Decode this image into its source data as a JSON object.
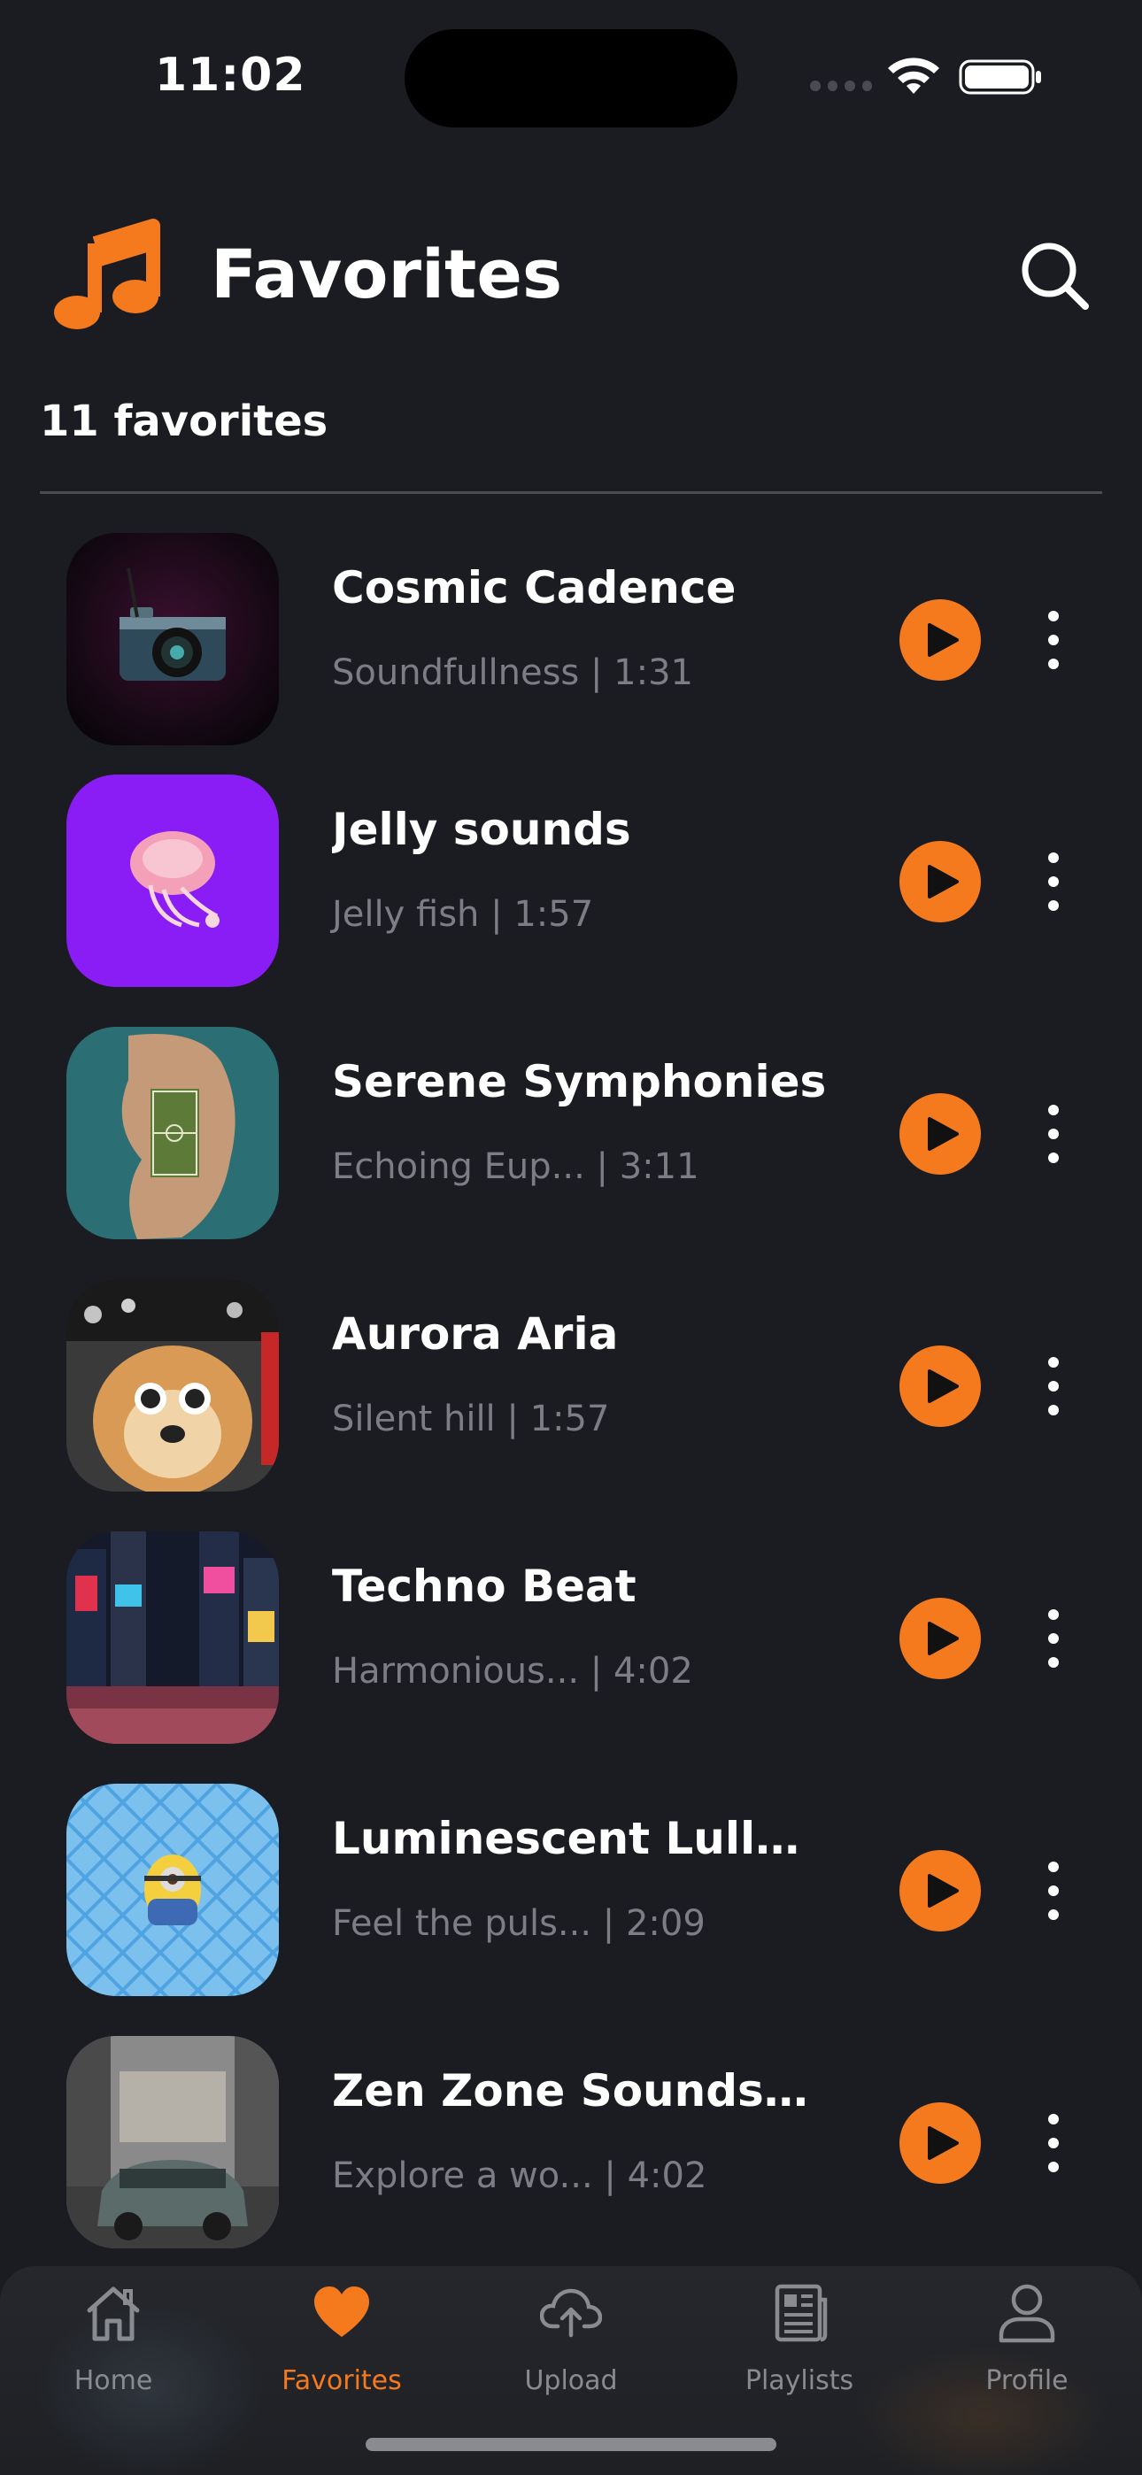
{
  "status_bar": {
    "time": "11:02"
  },
  "header": {
    "title": "Favorites"
  },
  "count_label": "11 favorites",
  "tracks": [
    {
      "title": "Cosmic Cadence",
      "meta": "Soundfullness | 1:31",
      "art": "camera-photo"
    },
    {
      "title": "Jelly sounds",
      "meta": "Jelly fish | 1:57",
      "art": "jellyfish-photo"
    },
    {
      "title": "Serene Symphonies",
      "meta": "Echoing Eup... | 3:11",
      "art": "island-field-photo"
    },
    {
      "title": "Aurora Aria",
      "meta": "Silent hill | 1:57",
      "art": "dog-sunglasses-photo"
    },
    {
      "title": "Techno Beat",
      "meta": "Harmonious... | 4:02",
      "art": "city-lights-photo"
    },
    {
      "title": "Luminescent Lulla...",
      "meta": "Feel the puls... | 2:09",
      "art": "minion-pool-photo"
    },
    {
      "title": "Zen Zone Soundsc...",
      "meta": "Explore a wo... | 4:02",
      "art": "sports-car-photo"
    }
  ],
  "tab_bar": {
    "tabs": [
      {
        "label": "Home",
        "icon": "home-icon",
        "active": false
      },
      {
        "label": "Favorites",
        "icon": "heart-icon",
        "active": true
      },
      {
        "label": "Upload",
        "icon": "cloud-upload-icon",
        "active": false
      },
      {
        "label": "Playlists",
        "icon": "newspaper-icon",
        "active": false
      },
      {
        "label": "Profile",
        "icon": "person-icon",
        "active": false
      }
    ]
  },
  "colors": {
    "background": "#1b1c21",
    "accent": "#f57a1e",
    "muted_text": "#7d7e85",
    "divider": "#4b4c52"
  }
}
